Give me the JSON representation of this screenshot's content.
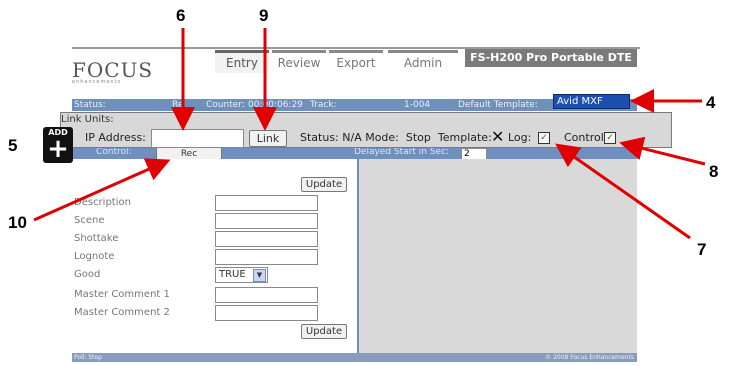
{
  "callouts": {
    "c4": "4",
    "c5": "5",
    "c6": "6",
    "c7": "7",
    "c8": "8",
    "c9": "9",
    "c10": "10"
  },
  "app": {
    "logo_main": "FOCUS",
    "logo_sub": "enhancements",
    "product_title": "FS-H200 Pro Portable DTE"
  },
  "tabs": [
    {
      "label": "Entry"
    },
    {
      "label": "Review"
    },
    {
      "label": "Export"
    },
    {
      "label": "Admin"
    }
  ],
  "status_bar": {
    "status_label": "Status:",
    "counter_label": "Re",
    "counter_label_rest": "Counter:",
    "counter_value": "00:00:06:29",
    "track_label": "Track:",
    "track_value": "1-004",
    "template_label": "Default Template:",
    "template_value": "Avid MXF"
  },
  "link_units": {
    "title": "Link Units:",
    "ip_label": "IP Address:",
    "ip_value": "",
    "link_button": "Link",
    "status_text": "Status: N/A Mode:  Stop  Template:",
    "template_mark": "✕",
    "log_label": "Log:",
    "control_label": "Control:",
    "log_checked": "✓",
    "control_checked": "✓"
  },
  "add_button": {
    "label": "ADD",
    "plus": "+"
  },
  "control_row": {
    "control_label": "Control:",
    "rec_button": "Rec",
    "delayed_label": "Delayed Start in Sec:",
    "delayed_value": "2"
  },
  "form": {
    "update_top": "Update",
    "update_bottom": "Update",
    "fields": [
      {
        "label": "Description"
      },
      {
        "label": "Scene"
      },
      {
        "label": "Shottake"
      },
      {
        "label": "Lognote"
      },
      {
        "label": "Good"
      },
      {
        "label": "Master Comment 1"
      },
      {
        "label": "Master Comment 2"
      }
    ],
    "good_value": "TRUE"
  },
  "footer": {
    "poll": "Poll: Stop",
    "copyright": "© 2008 Focus Enhancements"
  },
  "colors": {
    "accent": "#6f8fbf",
    "callout_arrow": "#e00000"
  }
}
